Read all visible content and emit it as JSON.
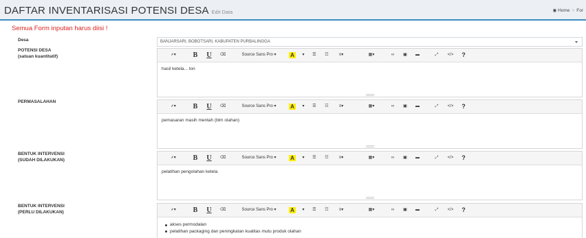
{
  "header": {
    "title": "DAFTAR INVENTARISASI POTENSI DESA",
    "subtitle": "Edit Data",
    "breadcrumb_home_icon": "dashboard-icon",
    "breadcrumb_home": "Home",
    "breadcrumb_next": "For"
  },
  "warning": "Semua Form inputan harus diisi !",
  "desa": {
    "label": "Desa",
    "value": "BANJARSARI, BOBOTSARI, KABUPATEN PURBALINGGA"
  },
  "toolbar": {
    "magic_icon": "⸙▾",
    "bold": "B",
    "underline": "U",
    "eraser_icon": "⌫",
    "font_name": "Source Sans Pro ▾",
    "color_label": "A",
    "color_caret": "▾",
    "ul_icon": "☰",
    "ol_icon": "☷",
    "align_icon": "≡▾",
    "table_icon": "▦▾",
    "link_icon": "∞",
    "picture_icon": "▣",
    "video_icon": "▬",
    "fullscreen_icon": "⤢",
    "code_icon": "</>",
    "help_icon": "?"
  },
  "fields": [
    {
      "label_line1": "POTENSI DESA",
      "label_line2": "(satuan kuantitatif)",
      "content": "hasil ketela... ton"
    },
    {
      "label_line1": "PERMASALAHAN",
      "label_line2": "",
      "content": "pemasaran masih mentah (blm olahan)"
    },
    {
      "label_line1": "BENTUK INTERVENSI",
      "label_line2": "(SUDAH DILAKUKAN)",
      "content": "pelatihan pengolahan ketela"
    },
    {
      "label_line1": "BENTUK INTERVENSI",
      "label_line2": "(PERLU DILAKUKAN)",
      "bullets": [
        "akses permodalan",
        "pelatihan packaging dan peningkatan kualitas mutu produk olahan"
      ]
    }
  ],
  "colors": {
    "accent": "#3c8dbc",
    "warning": "#dd2222",
    "highlight": "#ffee00"
  }
}
